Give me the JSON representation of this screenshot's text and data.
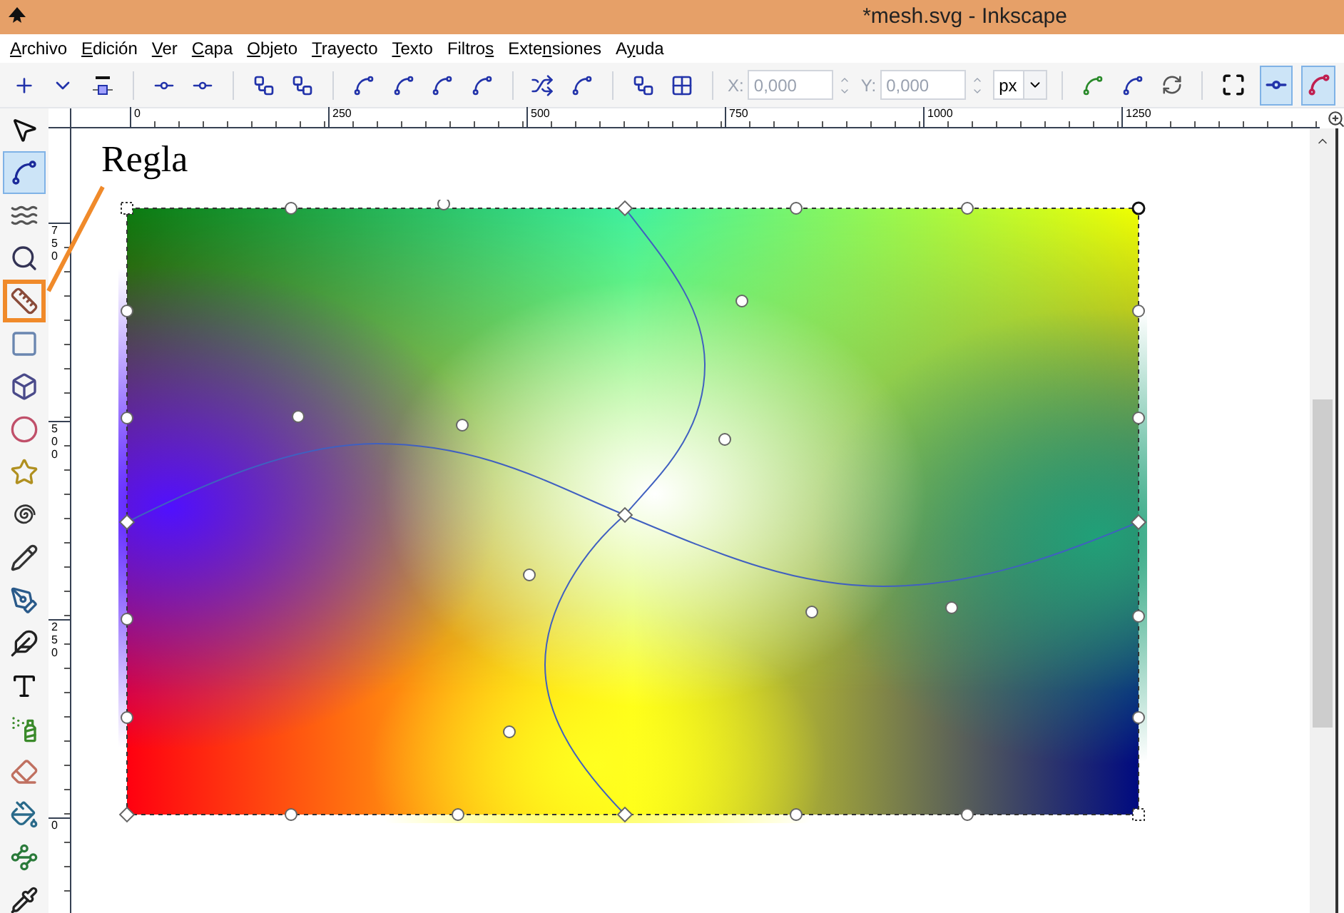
{
  "window": {
    "title": "*mesh.svg - Inkscape"
  },
  "menu": [
    {
      "key": "A",
      "post": "rchivo"
    },
    {
      "key": "E",
      "post": "dición"
    },
    {
      "key": "V",
      "post": "er"
    },
    {
      "key": "C",
      "post": "apa"
    },
    {
      "key": "O",
      "post": "bjeto"
    },
    {
      "key": "T",
      "post": "rayecto"
    },
    {
      "key": "T",
      "post": "exto"
    },
    {
      "pre": "Filtro",
      "key": "s"
    },
    {
      "pre": "Exte",
      "key": "n",
      "post": "siones"
    },
    {
      "pre": "A",
      "key": "y",
      "post": "uda"
    }
  ],
  "toolbar": {
    "x": {
      "label": "X:",
      "value": "0,000",
      "disabled": true
    },
    "y": {
      "label": "Y:",
      "value": "0,000",
      "disabled": true
    },
    "unit": "px",
    "toggles": [
      {
        "selected": false
      },
      {
        "selected": true
      },
      {
        "selected": true
      }
    ]
  },
  "rulers": {
    "horizontal": [
      "0",
      "250",
      "500",
      "750",
      "1000",
      "1250"
    ],
    "vertical": [
      "750",
      "500",
      "250",
      "0"
    ]
  },
  "tools": [
    {
      "selected": false,
      "annotated": false
    },
    {
      "selected": true,
      "annotated": false
    },
    {
      "selected": false,
      "annotated": false
    },
    {
      "selected": false,
      "annotated": false
    },
    {
      "selected": false,
      "annotated": true
    },
    {
      "selected": false,
      "annotated": false
    },
    {
      "selected": false,
      "annotated": false
    },
    {
      "selected": false,
      "annotated": false
    },
    {
      "selected": false,
      "annotated": false
    },
    {
      "selected": false,
      "annotated": false
    },
    {
      "selected": false,
      "annotated": false
    },
    {
      "selected": false,
      "annotated": false
    },
    {
      "selected": false,
      "annotated": false
    },
    {
      "selected": false,
      "annotated": false
    },
    {
      "selected": false,
      "annotated": false
    },
    {
      "selected": false,
      "annotated": false
    },
    {
      "selected": false,
      "annotated": false
    },
    {
      "selected": false,
      "annotated": false
    },
    {
      "selected": false,
      "annotated": false
    }
  ],
  "annotation": {
    "label": "Regla"
  }
}
